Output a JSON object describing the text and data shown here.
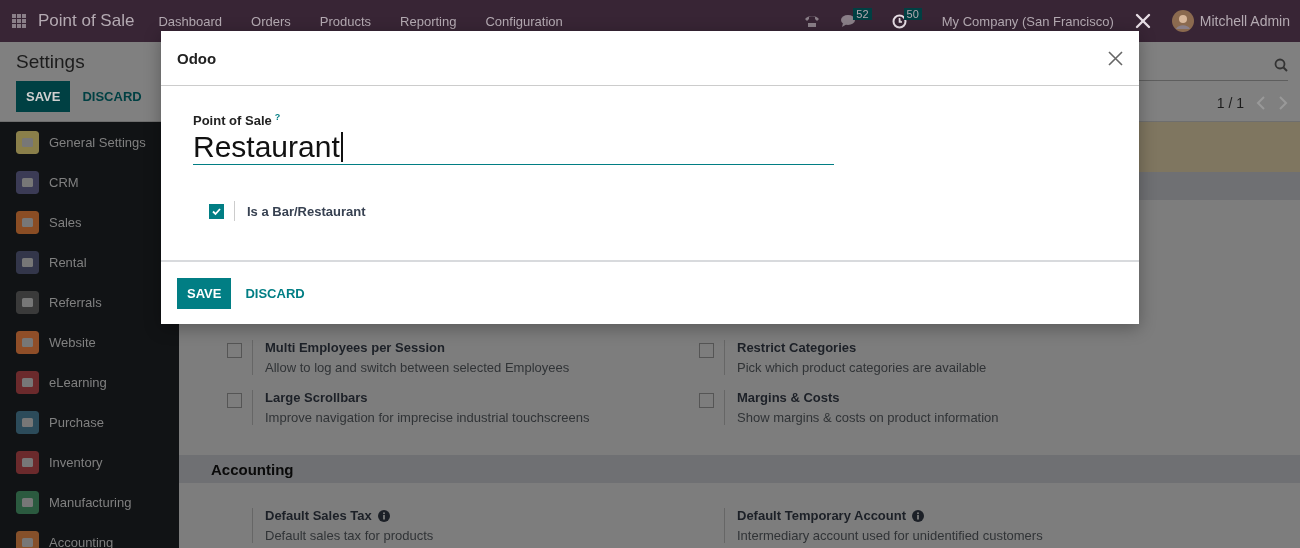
{
  "navbar": {
    "app_name": "Point of Sale",
    "menus": [
      "Dashboard",
      "Orders",
      "Products",
      "Reporting",
      "Configuration"
    ],
    "chat_count": "52",
    "activity_count": "50",
    "company": "My Company (San Francisco)",
    "user": "Mitchell Admin"
  },
  "control_panel": {
    "title": "Settings",
    "save": "SAVE",
    "discard": "DISCARD",
    "pager": "1 / 1"
  },
  "sidebar": {
    "items": [
      {
        "label": "General Settings",
        "color": "#8a7f4a"
      },
      {
        "label": "CRM",
        "color": "#3b3b55"
      },
      {
        "label": "Sales",
        "color": "#8a4d24"
      },
      {
        "label": "Rental",
        "color": "#33364a"
      },
      {
        "label": "Referrals",
        "color": "#3a3a3a"
      },
      {
        "label": "Website",
        "color": "#8f4e28"
      },
      {
        "label": "eLearning",
        "color": "#6b2a2c"
      },
      {
        "label": "Purchase",
        "color": "#2c4b5a"
      },
      {
        "label": "Inventory",
        "color": "#6b2a2c"
      },
      {
        "label": "Manufacturing",
        "color": "#2b5a3f"
      },
      {
        "label": "Accounting",
        "color": "#85502a"
      }
    ]
  },
  "settings_rows": [
    {
      "title": "Multi Employees per Session",
      "description": "Allow to log and switch between selected Employees",
      "checked": false
    },
    {
      "title": "Restrict Categories",
      "description": "Pick which product categories are available",
      "checked": false
    },
    {
      "title": "Large Scrollbars",
      "description": "Improve navigation for imprecise industrial touchscreens",
      "checked": false
    },
    {
      "title": "Margins & Costs",
      "description": "Show margins & costs on product information",
      "checked": false
    }
  ],
  "accounting": {
    "title": "Accounting",
    "rows": [
      {
        "title": "Default Sales Tax",
        "description": "Default sales tax for products"
      },
      {
        "title": "Default Temporary Account",
        "description": "Intermediary account used for unidentified customers"
      }
    ]
  },
  "dialog": {
    "title": "Odoo",
    "field_label": "Point of Sale",
    "help_mark": "?",
    "value": "Restaurant",
    "checkbox": {
      "label": "Is a Bar/Restaurant",
      "checked": true
    },
    "save": "SAVE",
    "discard": "DISCARD"
  }
}
